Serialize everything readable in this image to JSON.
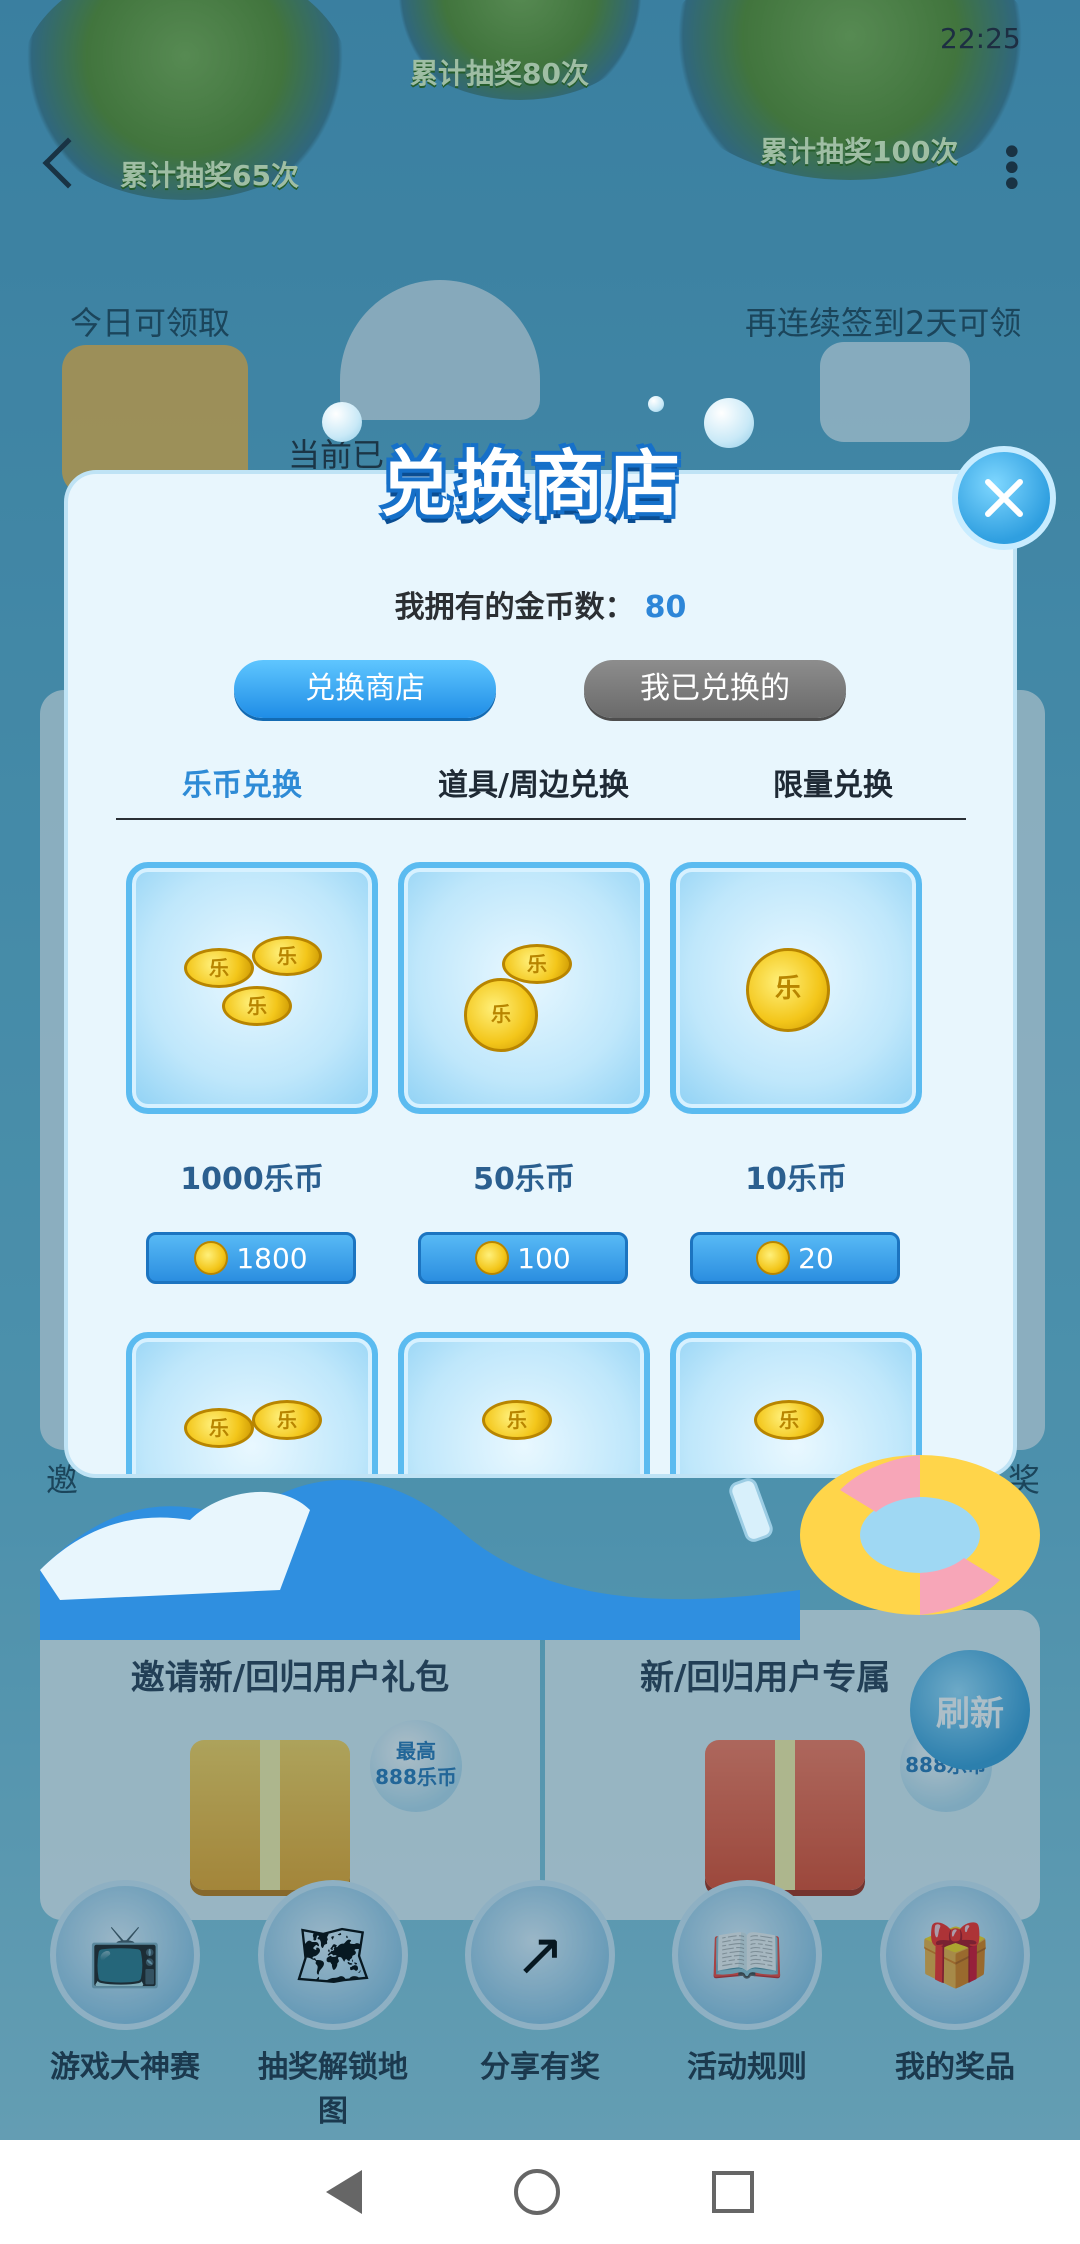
{
  "status_bar": {
    "time": "22:25"
  },
  "background": {
    "island_labels": [
      "累计抽奖65次",
      "累计抽奖80次",
      "累计抽奖100次"
    ],
    "left_caption": "今日可领取",
    "right_caption": "再连续签到2天可领",
    "partial_text": "当前已",
    "left_side_partial": "邀",
    "right_side_partial": "奖"
  },
  "modal": {
    "title": "兑换商店",
    "coins_label": "我拥有的金币数：",
    "coins_value": "80",
    "tabs": [
      {
        "label": "兑换商店",
        "active": true
      },
      {
        "label": "我已兑换的",
        "active": false
      }
    ],
    "subtabs": [
      {
        "label": "乐币兑换",
        "active": true
      },
      {
        "label": "道具/周边兑换",
        "active": false
      },
      {
        "label": "限量兑换",
        "active": false
      }
    ],
    "items": [
      {
        "name": "1000乐币",
        "price": "1800"
      },
      {
        "name": "50乐币",
        "price": "100"
      },
      {
        "name": "10乐币",
        "price": "20"
      }
    ]
  },
  "bottom_cards": [
    {
      "title": "邀请新/回归用户礼包",
      "badge_line1": "最高",
      "badge_line2": "888乐币"
    },
    {
      "title": "新/回归用户专属",
      "badge_line2": "888乐币",
      "refresh_label": "刷新"
    }
  ],
  "nav": [
    {
      "label": "游戏大神赛",
      "icon": "tv-icon"
    },
    {
      "label": "抽奖解锁地图",
      "icon": "map-icon"
    },
    {
      "label": "分享有奖",
      "icon": "share-icon"
    },
    {
      "label": "活动规则",
      "icon": "book-icon"
    },
    {
      "label": "我的奖品",
      "icon": "gift-icon"
    }
  ],
  "colors": {
    "accent": "#2e8bd6",
    "coin": "#f3c61a",
    "modal_bg": "#e8f6fd"
  }
}
